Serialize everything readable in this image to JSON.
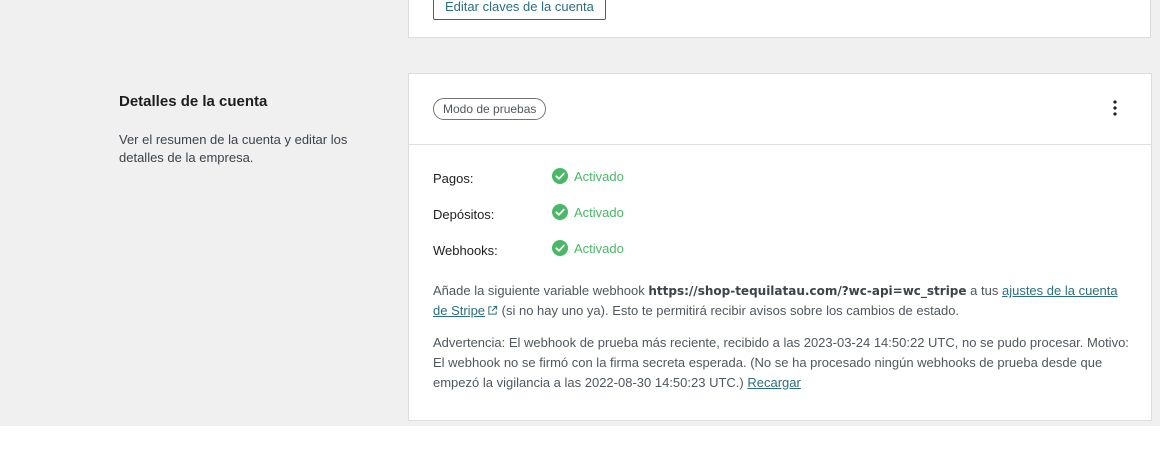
{
  "top_card": {
    "edit_keys_label": "Editar claves de la cuenta"
  },
  "section": {
    "title": "Detalles de la cuenta",
    "description": "Ver el resumen de la cuenta y editar los detalles de la empresa."
  },
  "card": {
    "mode_badge": "Modo de pruebas",
    "statuses": [
      {
        "label": "Pagos:",
        "value": "Activado"
      },
      {
        "label": "Depósitos:",
        "value": "Activado"
      },
      {
        "label": "Webhooks:",
        "value": "Activado"
      }
    ],
    "webhook_note": {
      "prefix": "Añade la siguiente variable webhook ",
      "url": "https://shop-tequilatau.com/?wc-api=wc_stripe",
      "middle": " a tus ",
      "link": "ajustes de la cuenta de Stripe",
      "suffix": " (si no hay uno ya). Esto te permitirá recibir avisos sobre los cambios de estado."
    },
    "warning": {
      "text": "Advertencia: El webhook de prueba más reciente, recibido a las 2023-03-24 14:50:22 UTC, no se pudo procesar. Motivo: El webhook no se firmó con la firma secreta esperada. (No se ha procesado ningún webhooks de prueba desde que empezó la vigilancia a las 2022-08-30 14:50:23 UTC.) ",
      "reload_link": "Recargar"
    }
  },
  "colors": {
    "accent": "#2c6e7f",
    "success": "#4ab866",
    "background": "#f0f0f0"
  },
  "icons": {
    "menu": "more-vertical-icon",
    "status": "check-circle-icon",
    "external": "external-link-icon"
  }
}
